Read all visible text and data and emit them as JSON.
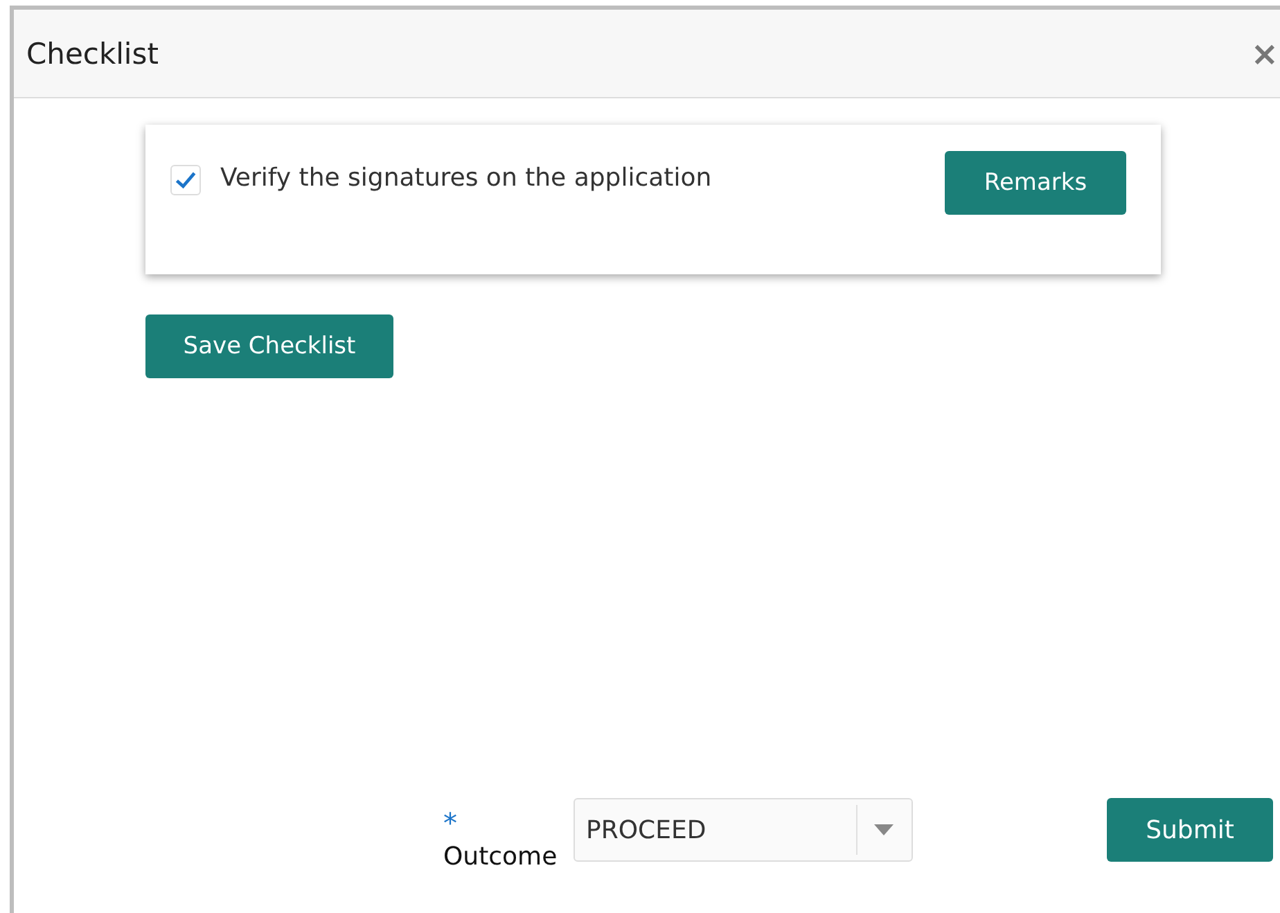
{
  "dialog": {
    "title": "Checklist",
    "close": "×"
  },
  "checklist": [
    {
      "label": "Verify the signatures on the application",
      "checked": true,
      "button": "Remarks"
    }
  ],
  "save_button": "Save Checklist",
  "outcome": {
    "required_mark": "*",
    "label": "Outcome",
    "value": "PROCEED"
  },
  "submit_button": "Submit"
}
